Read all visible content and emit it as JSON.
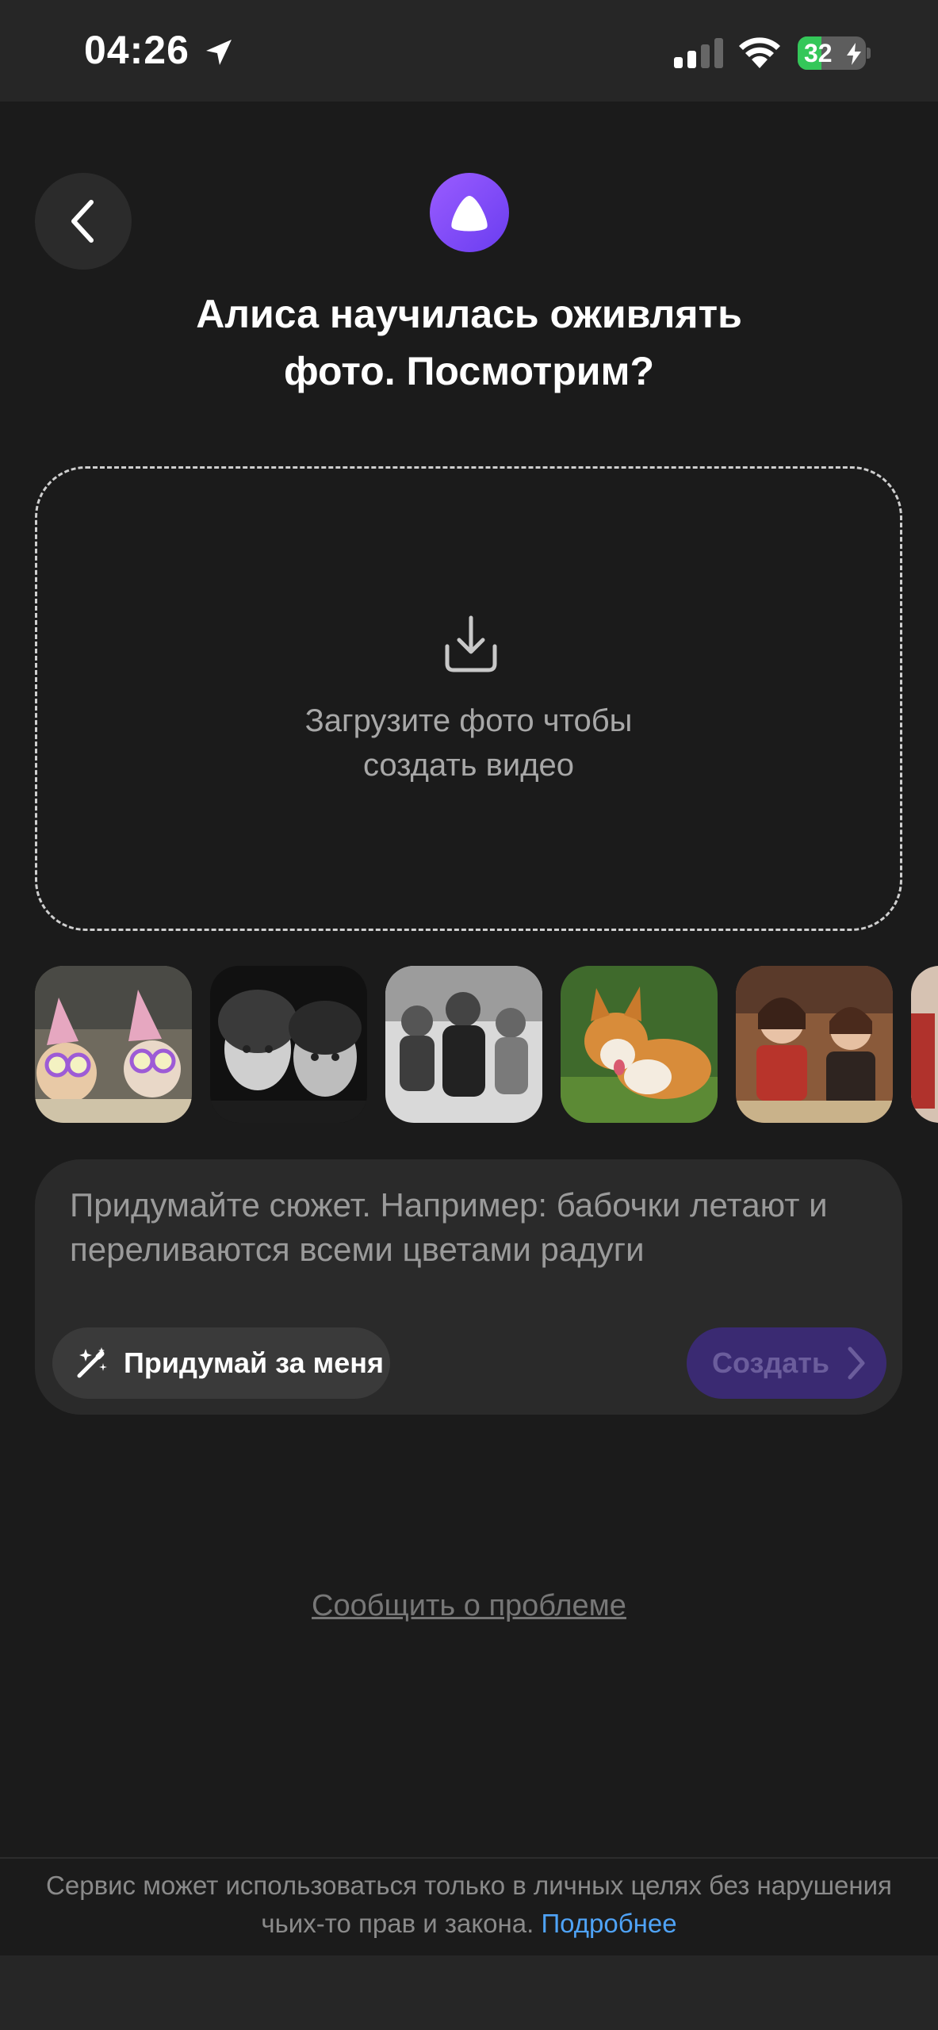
{
  "status_bar": {
    "time": "04:26",
    "battery": "32"
  },
  "header": {
    "title_line1": "Алиса научилась оживлять",
    "title_line2": "фото. Посмотрим?"
  },
  "upload": {
    "line1": "Загрузите фото чтобы",
    "line2": "создать видео"
  },
  "examples": [
    {
      "name": "cats-party"
    },
    {
      "name": "children-bw"
    },
    {
      "name": "kids-winter-bw"
    },
    {
      "name": "corgi"
    },
    {
      "name": "girls-school"
    },
    {
      "name": "partial"
    }
  ],
  "prompt": {
    "placeholder": "Придумайте сюжет. Например: бабочки летают и переливаются всеми цветами радуги",
    "suggest_label": "Придумай за меня",
    "create_label": "Создать"
  },
  "report_link": "Сообщить о проблеме",
  "footer": {
    "text": "Сервис может использоваться только в личных целях без нарушения чьих-то прав и закона.",
    "link": "Подробнее"
  },
  "colors": {
    "background": "#1b1b1b",
    "accent": "#7a4cf5",
    "link": "#4fa3f7",
    "battery": "#34c759"
  }
}
